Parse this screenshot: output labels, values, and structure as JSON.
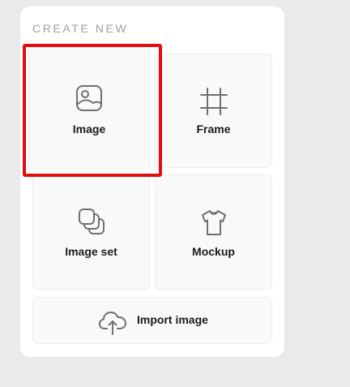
{
  "panel": {
    "section_title": "CREATE NEW",
    "tiles": [
      {
        "label": "Image",
        "icon": "image-icon"
      },
      {
        "label": "Frame",
        "icon": "frame-icon"
      },
      {
        "label": "Image set",
        "icon": "image-set-icon"
      },
      {
        "label": "Mockup",
        "icon": "tshirt-icon"
      },
      {
        "label": "Import image",
        "icon": "cloud-upload-icon"
      }
    ]
  },
  "colors": {
    "background": "#e9eaec",
    "panel": "#ffffff",
    "tile": "#f9f9f9",
    "highlight": "#e20d0d",
    "icon_stroke": "#707070"
  }
}
